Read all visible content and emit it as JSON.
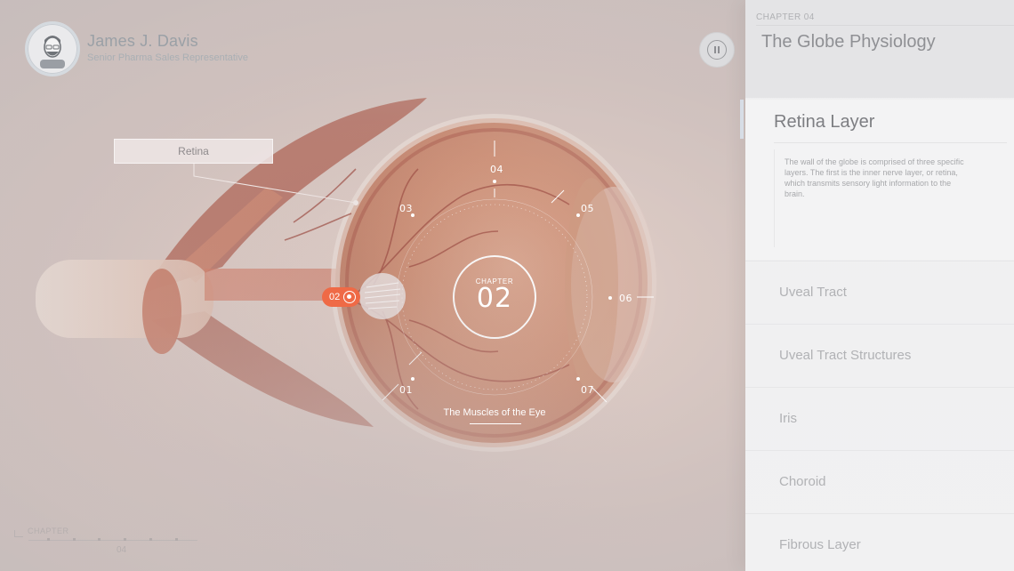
{
  "user": {
    "name": "James J. Davis",
    "role": "Senior Pharma Sales Representative",
    "avatar_icon": "user-avatar-icon"
  },
  "callout": {
    "label": "Retina"
  },
  "dial": {
    "center_caption": "CHAPTER",
    "center_number": "02",
    "subtitle": "The Muscles of the Eye",
    "active_chapter": "02",
    "nodes": {
      "n01": "01",
      "n03": "03",
      "n04": "04",
      "n05": "05",
      "n06": "06",
      "n07": "07"
    }
  },
  "bottom_nav": {
    "label": "CHAPTER",
    "number": "04"
  },
  "panel": {
    "chapter_label": "CHAPTER 04",
    "chapter_title": "The Globe Physiology",
    "active_item": {
      "title": "Retina Layer",
      "description": "The wall of the globe is comprised of three specific layers. The first is the inner nerve layer, or retina, which transmits sensory light information to the brain."
    },
    "items": [
      {
        "label": "Uveal Tract"
      },
      {
        "label": "Uveal Tract Structures"
      },
      {
        "label": "Iris"
      },
      {
        "label": "Choroid"
      },
      {
        "label": "Fibrous Layer"
      }
    ]
  },
  "colors": {
    "accent": "#ef6a46",
    "panel_bg": "#f1f1f2",
    "muted_text": "#b1b2b5"
  }
}
